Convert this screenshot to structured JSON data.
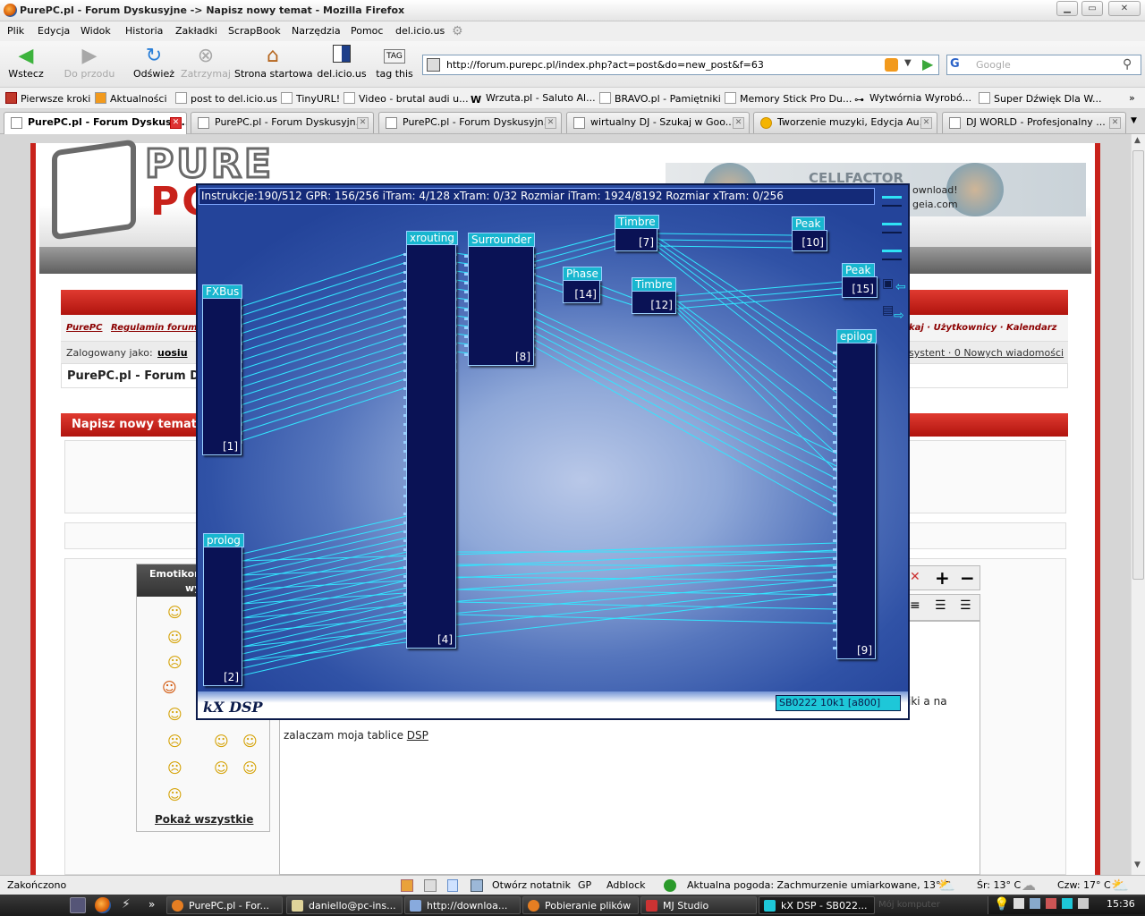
{
  "window": {
    "title": "PurePC.pl - Forum Dyskusyjne -> Napisz nowy temat - Mozilla Firefox"
  },
  "menu": [
    "Plik",
    "Edycja",
    "Widok",
    "Historia",
    "Zakładki",
    "ScrapBook",
    "Narzędzia",
    "Pomoc",
    "del.icio.us"
  ],
  "nav": {
    "back": "Wstecz",
    "forward": "Do przodu",
    "reload": "Odśwież",
    "stop": "Zatrzymaj",
    "home": "Strona startowa",
    "delicious": "del.icio.us",
    "tagthis": "tag this",
    "tag_icon_text": "TAG",
    "url": "http://forum.purepc.pl/index.php?act=post&do=new_post&f=63",
    "search_placeholder": "Google"
  },
  "bookmarks": [
    "Pierwsze kroki",
    "Aktualności",
    "post to del.icio.us",
    "TinyURL!",
    "Video - brutal audi u...",
    "Wrzuta.pl - Saluto Al...",
    "BRAVO.pl - Pamiętniki",
    "Memory Stick Pro Du...",
    "Wytwórnia Wyrobó...",
    "Super Dźwięk Dla W..."
  ],
  "tabs": [
    "PurePC.pl - Forum Dyskusyj...",
    "PurePC.pl - Forum Dyskusyjn...",
    "PurePC.pl - Forum Dyskusyjn...",
    "wirtualny DJ - Szukaj w Goo...",
    "Tworzenie muzyki, Edycja Au...",
    "DJ WORLD - Profesjonalny ..."
  ],
  "page": {
    "logo": "PURE",
    "logo2": "PC",
    "ad_text1": "ownload!",
    "ad_text2": "geia.com",
    "ad_text3": "CELLFACTOR",
    "nav_links": [
      "PurePC",
      "Regulamin forum"
    ],
    "nav_right": "kaj · Użytkownicy · Kalendarz",
    "logged_label": "Zalogowany jako:",
    "logged_user": "uosiu",
    "logged_right": "systent · 0 Nowych wiadomości",
    "breadcrumb": "PurePC.pl - Forum D",
    "new_topic_header": "Napisz nowy temat w",
    "emoticons_header": "Emotikony",
    "emoticons_header2": "wy",
    "show_all": "Pokaż wszystkie",
    "post_text_prefix": "zalaczam moja tablice",
    "post_text_link": "DSP",
    "post_text_right": "iki a na"
  },
  "dsp": {
    "info": "Instrukcje:190/512 GPR: 156/256 iTram: 4/128 xTram: 0/32 Rozmiar iTram: 1924/8192 Rozmiar xTram: 0/256",
    "logo": "kX DSP",
    "card": "SB0222 10k1 [a800]",
    "blocks": [
      {
        "name": "FXBus",
        "num": "[1]"
      },
      {
        "name": "prolog",
        "num": "[2]"
      },
      {
        "name": "xrouting",
        "num": "[4]"
      },
      {
        "name": "Surrounder",
        "num": "[8]"
      },
      {
        "name": "Timbre",
        "num": "[7]"
      },
      {
        "name": "Phase",
        "num": "[14]"
      },
      {
        "name": "Timbre",
        "num": "[12]"
      },
      {
        "name": "Peak",
        "num": "[10]"
      },
      {
        "name": "Peak",
        "num": "[15]"
      },
      {
        "name": "epilog",
        "num": "[9]"
      }
    ]
  },
  "status": {
    "left": "Zakończono",
    "notes": "Otwórz notatnik",
    "gp": "GP",
    "adblock": "Adblock",
    "weather": "Aktualna pogoda: Zachmurzenie umiarkowane, 13° C",
    "wed": "Śr: 13° C",
    "thu": "Czw: 17° C"
  },
  "taskbar": {
    "items": [
      "PurePC.pl - For...",
      "daniello@pc-ins...",
      "http://downloa...",
      "Pobieranie plików",
      "MJ Studio",
      "kX DSP - SB022..."
    ],
    "tray_ghost": "Mój komputer",
    "clock": "15:36"
  }
}
